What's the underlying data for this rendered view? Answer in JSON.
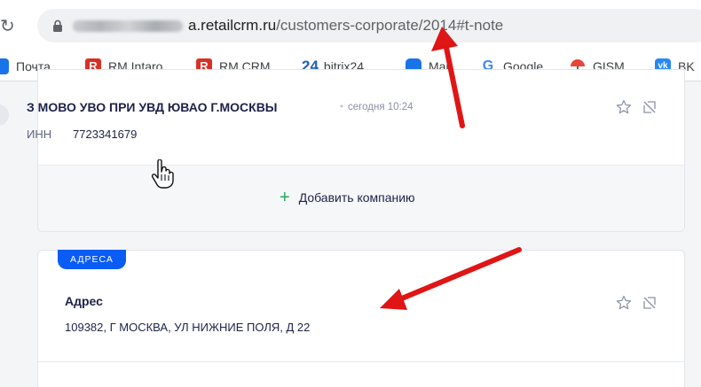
{
  "browser": {
    "url_host": "a.retailcrm.ru",
    "url_path": "/customers-corporate/2014#t-note",
    "bookmarks": [
      {
        "label": "Почта",
        "icon": "mail-icon",
        "color": "#1a73e8"
      },
      {
        "label": "RM Intaro",
        "icon": "r-logo-icon",
        "color": "#d93025"
      },
      {
        "label": "RM CRM",
        "icon": "r-logo-icon",
        "color": "#d93025"
      },
      {
        "label": "bitrix24",
        "icon": "bitrix24-icon",
        "color": "#2fa7e0"
      },
      {
        "label": "Mail",
        "icon": "mail-icon",
        "color": "#1a73e8"
      },
      {
        "label": "Google",
        "icon": "google-icon",
        "color": "#4285f4"
      },
      {
        "label": "GISM",
        "icon": "umbrella-icon",
        "color": "#e8453c"
      },
      {
        "label": "BK",
        "icon": "vk-icon",
        "color": "#2787f5"
      }
    ]
  },
  "company": {
    "name": "З МОВО УВО ПРИ УВД ЮВАО Г.МОСКВЫ",
    "time": "сегодня 10:24",
    "inn_label": "ИНН",
    "inn_value": "7723341679",
    "add_label": "Добавить компанию"
  },
  "address_section": {
    "tag": "АДРЕСА",
    "title": "Адрес",
    "value": "109382, Г МОСКВА, УЛ НИЖНИЕ ПОЛЯ, Д 22"
  },
  "colors": {
    "accent": "#0a5cf5",
    "add_plus": "#22a85b",
    "annotation_arrow": "#e01515"
  }
}
